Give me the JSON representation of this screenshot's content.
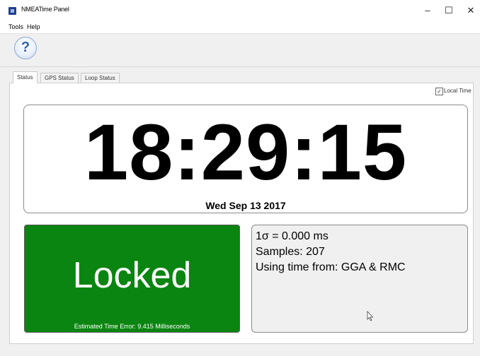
{
  "window": {
    "title": "NMEATime Panel",
    "icon": "app-icon",
    "controls": {
      "minimize": "–",
      "maximize": "☐",
      "close": "✕"
    }
  },
  "menu": {
    "items": [
      "Tools",
      "Help"
    ]
  },
  "toolbar": {
    "help_icon": "help-icon",
    "help_glyph": "?"
  },
  "tabs": [
    {
      "label": "Status",
      "active": true
    },
    {
      "label": "GPS Status",
      "active": false
    },
    {
      "label": "Loop Status",
      "active": false
    }
  ],
  "status": {
    "local_time_label": "Local Time",
    "local_time_checked": true,
    "check_glyph": "✓",
    "time": "18:29:15",
    "date": "Wed Sep 13 2017",
    "lock": {
      "label": "Locked",
      "estimated_error": "Estimated Time Error: 9.415 Milliseconds",
      "color": "#0b8511"
    },
    "stats": {
      "sigma": "1σ = 0.000 ms",
      "samples": "Samples: 207",
      "source": "Using time from: GGA & RMC"
    }
  }
}
